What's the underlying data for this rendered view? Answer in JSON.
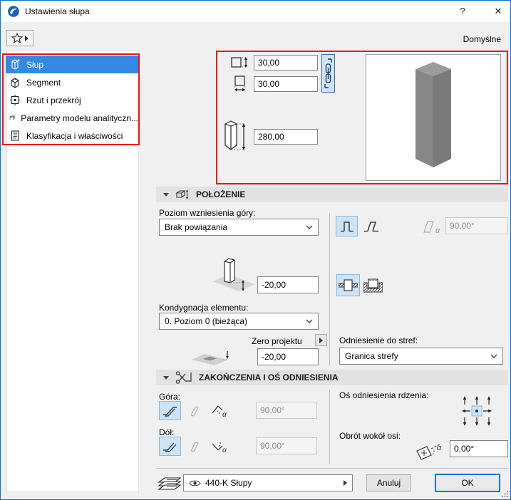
{
  "window": {
    "title": "Ustawienia słupa",
    "help": "?",
    "close": "✕",
    "defaults_label": "Domyślne"
  },
  "sidebar": {
    "items": [
      {
        "label": "Słup",
        "icon": "column-icon",
        "selected": true
      },
      {
        "label": "Segment",
        "icon": "segment-icon",
        "selected": false
      },
      {
        "label": "Rzut i przekrój",
        "icon": "plan-section-icon",
        "selected": false
      },
      {
        "label": "Parametry modelu analityczn...",
        "icon": "analytical-model-icon",
        "selected": false
      },
      {
        "label": "Klasyfikacja i właściwości",
        "icon": "classification-icon",
        "selected": false
      }
    ]
  },
  "geometry": {
    "profile_height": "30,00",
    "profile_width": "30,00",
    "column_height": "280,00"
  },
  "position": {
    "header": "POŁOŻENIE",
    "top_level_label": "Poziom wzniesienia góry:",
    "top_level_value": "Brak powiązania",
    "slant_angle": "90,00°",
    "offset_value": "-20,00",
    "story_label": "Kondygnacja elementu:",
    "story_value": "0. Poziom 0 (bieżąca)",
    "project_zero_label": "Zero projektu",
    "project_zero_value": "-20,00",
    "zones_label": "Odniesienie do stref:",
    "zones_value": "Granica strefy"
  },
  "endings": {
    "header": "ZAKOŃCZENIA I OŚ ODNIESIENIA",
    "top_label": "Góra:",
    "top_angle": "90,00°",
    "bottom_label": "Dół:",
    "bottom_angle": "90,00°",
    "core_axis_label": "Oś odniesienia rdzenia:",
    "rotation_label": "Obrót wokół osi:",
    "rotation_value": "0,00°"
  },
  "footer": {
    "layer": "440-K Słupy",
    "cancel": "Anuluj",
    "ok": "OK"
  },
  "icons": {
    "alpha": "α",
    "dropdown_chevron": "chevron-down-icon",
    "favorites": "star-icon",
    "link": "chain-icon",
    "section_position": "column-elevation-icon",
    "section_endings": "scissors-icon",
    "layers": "layers-icon",
    "visibility": "eye-icon"
  },
  "colors": {
    "accent_blue": "#0077d4",
    "selection_blue": "#3388e3",
    "highlight_red": "#ee1111",
    "toggle_selected_bg": "#cde4f7",
    "section_strip": "#e2e2e2"
  }
}
